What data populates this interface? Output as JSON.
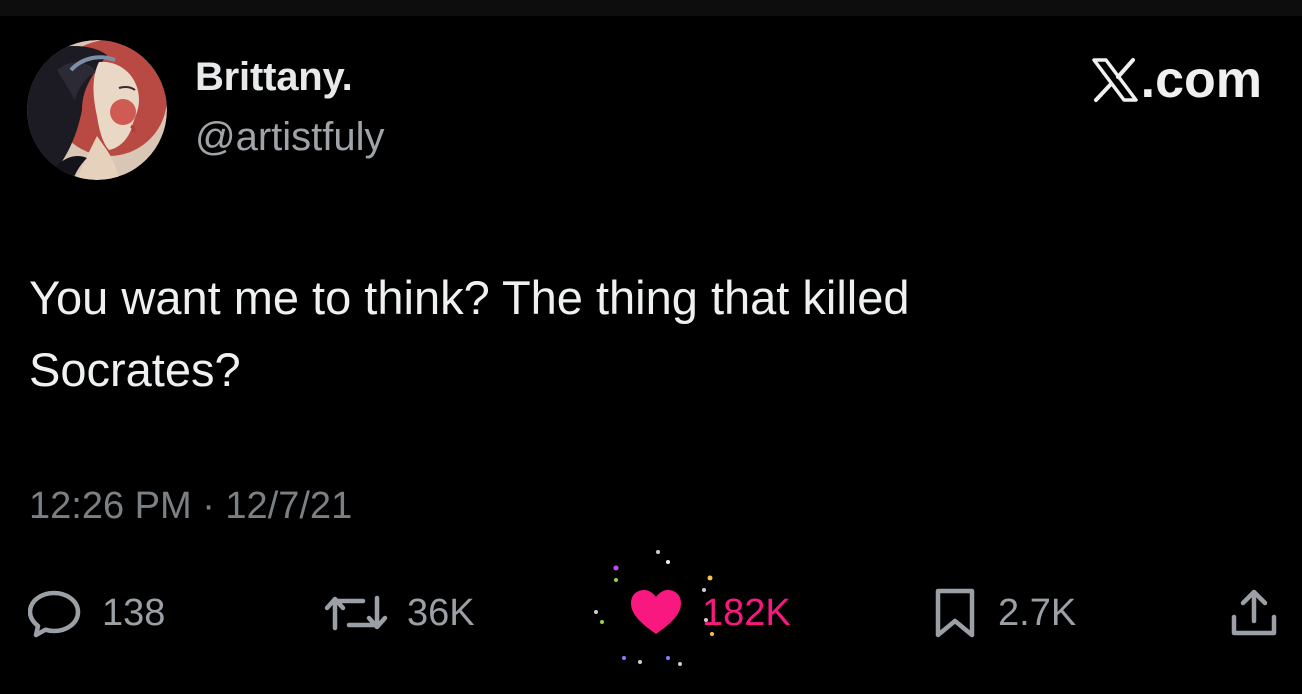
{
  "author": {
    "display_name": "Brittany.",
    "handle": "@artistfuly",
    "avatar_icon": "illustrated-woman-portrait-avatar"
  },
  "brand": {
    "label": ".com",
    "logo_icon": "x-logo-icon"
  },
  "tweet": {
    "lines": [
      "You want me to think? The thing that killed",
      "Socrates?"
    ]
  },
  "meta": {
    "timestamp": "12:26 PM · 12/7/21"
  },
  "actions": {
    "reply": {
      "icon": "reply-bubble-icon",
      "count": "138"
    },
    "retweet": {
      "icon": "retweet-icon",
      "count": "36K"
    },
    "like": {
      "icon": "heart-icon",
      "count": "182K",
      "color": "#f91880"
    },
    "bookmark": {
      "icon": "bookmark-icon",
      "count": "2.7K"
    },
    "share": {
      "icon": "share-icon"
    }
  },
  "colors": {
    "background": "#000000",
    "text_primary": "#e7e9ea",
    "text_secondary": "#7b8085",
    "like_accent": "#f91880"
  }
}
